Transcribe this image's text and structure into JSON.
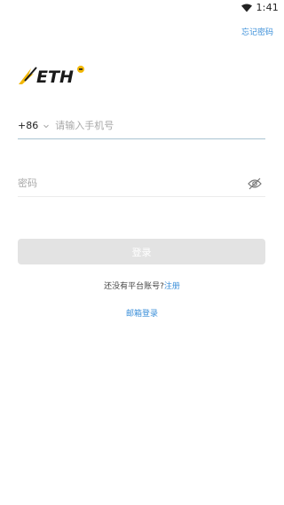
{
  "status_bar": {
    "time": "1:41",
    "wifi_icon": "wifi-icon"
  },
  "header": {
    "forgot_password": "忘记密码"
  },
  "logo": {
    "text": "ETH",
    "icon": "eth-logo"
  },
  "phone": {
    "country_code": "+86",
    "placeholder": "请输入手机号"
  },
  "password": {
    "placeholder": "密码",
    "toggle_icon": "eye-off-icon"
  },
  "login_button": {
    "label": "登录"
  },
  "register": {
    "prompt": "还没有平台账号?",
    "link": "注册"
  },
  "email_login": {
    "label": "邮箱登录"
  },
  "colors": {
    "accent": "#3b8fd9",
    "button_disabled": "#e3e3e3",
    "logo_yellow": "#f2b705"
  }
}
